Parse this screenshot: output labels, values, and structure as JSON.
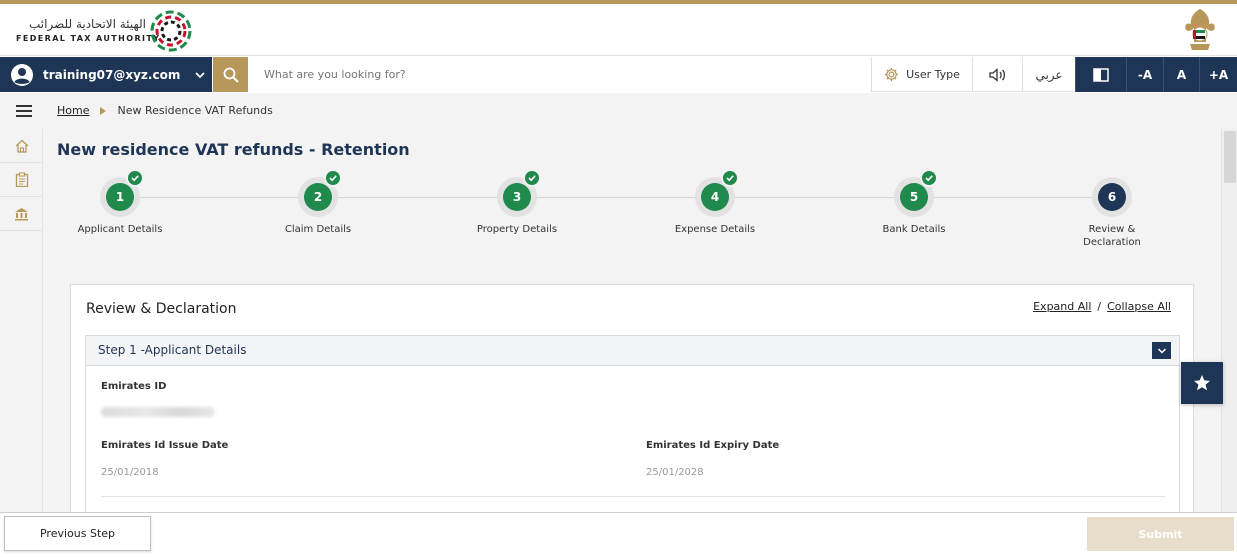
{
  "header": {
    "logo_arabic": "الهيئة الاتحادية للضرائب",
    "logo_english": "FEDERAL TAX AUTHORITY"
  },
  "toolbar": {
    "user_email": "training07@xyz.com",
    "search_placeholder": "What are you looking for?",
    "user_type_label": "User Type",
    "arabic_label": "عربي",
    "font_decrease_label": "-A",
    "font_normal_label": "A",
    "font_increase_label": "+A"
  },
  "breadcrumb": {
    "home": "Home",
    "current": "New Residence VAT Refunds"
  },
  "page": {
    "title": "New residence VAT refunds - Retention"
  },
  "steps": [
    {
      "number": "1",
      "label": "Applicant Details",
      "completed": true
    },
    {
      "number": "2",
      "label": "Claim Details",
      "completed": true
    },
    {
      "number": "3",
      "label": "Property Details",
      "completed": true
    },
    {
      "number": "4",
      "label": "Expense Details",
      "completed": true
    },
    {
      "number": "5",
      "label": "Bank Details",
      "completed": true
    },
    {
      "number": "6",
      "label": "Review & Declaration",
      "completed": false
    }
  ],
  "review": {
    "title": "Review & Declaration",
    "expand_all": "Expand All",
    "separator": "/",
    "collapse_all": "Collapse All",
    "section_title": "Step 1 -Applicant Details",
    "fields": {
      "emirates_id_label": "Emirates ID",
      "issue_date_label": "Emirates Id Issue Date",
      "issue_date_value": "25/01/2018",
      "expiry_date_label": "Emirates Id Expiry Date",
      "expiry_date_value": "25/01/2028"
    }
  },
  "footer": {
    "previous_label": "Previous Step",
    "submit_label": "Submit"
  },
  "colors": {
    "navy": "#1f3555",
    "gold": "#b8985a",
    "green": "#1f8a4c",
    "submit_disabled": "#e8dccb"
  }
}
